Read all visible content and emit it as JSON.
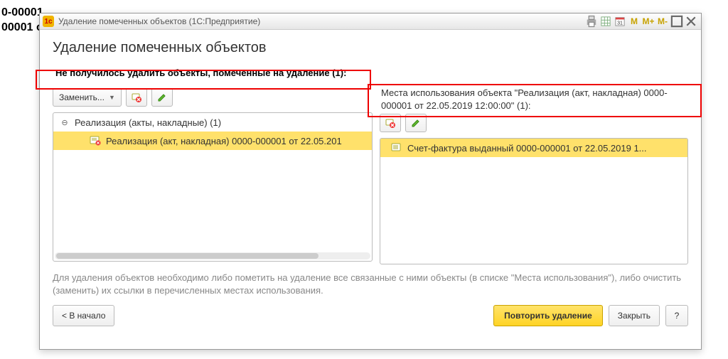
{
  "background": {
    "line1": "0-00001",
    "line2": "00001 о"
  },
  "window": {
    "title": "Удаление помеченных объектов  (1С:Предприятие)",
    "toolbar": {
      "m": "M",
      "mplus": "M+",
      "mminus": "M-"
    }
  },
  "heading": "Удаление помеченных объектов",
  "fail_message": "Не получилось удалить объекты, помеченные на удаление (1):",
  "left": {
    "replace": "Заменить...",
    "tree": {
      "group": "Реализация (акты, накладные) (1)",
      "item": "Реализация (акт, накладная) 0000-000001 от 22.05.201"
    }
  },
  "right": {
    "usage_label": "Места использования объекта \"Реализация (акт, накладная) 0000-000001 от 22.05.2019 12:00:00\" (1):",
    "item": "Счет-фактура выданный 0000-000001 от 22.05.2019 1..."
  },
  "hint": "Для удаления объектов необходимо либо пометить на удаление все связанные с ними объекты (в списке \"Места использования\"), либо очистить (заменить) их ссылки в перечисленных местах использования.",
  "footer": {
    "back": "< В начало",
    "retry": "Повторить удаление",
    "close": "Закрыть",
    "help": "?"
  }
}
